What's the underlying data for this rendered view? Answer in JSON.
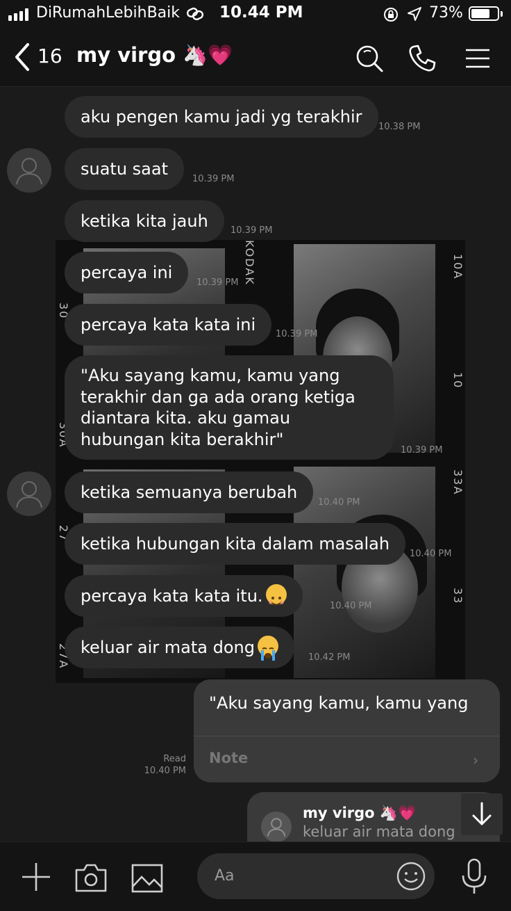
{
  "status_bar": {
    "carrier": "DiRumahLebihBaik",
    "time": "10.44 PM",
    "battery_percent": "73%",
    "battery_level": 0.73
  },
  "header": {
    "unread_count": "16",
    "chat_title": "my virgo 🦄💗"
  },
  "messages": [
    {
      "text": "aku pengen kamu jadi yg terakhir",
      "time": "10.38 PM"
    },
    {
      "text": "suatu saat",
      "time": "10.39 PM"
    },
    {
      "text": "ketika kita jauh",
      "time": "10.39 PM"
    },
    {
      "text": "percaya ini",
      "time": "10.39 PM"
    },
    {
      "text": "percaya kata kata ini",
      "time": "10.39 PM"
    },
    {
      "text": "\"Aku sayang kamu, kamu yang terakhir dan ga ada orang ketiga diantara kita. aku gamau hubungan kita berakhir\"",
      "time": "10.39 PM"
    },
    {
      "text": "ketika semuanya berubah",
      "time": "10.40 PM"
    },
    {
      "text": "ketika hubungan kita dalam masalah",
      "time": "10.40 PM"
    },
    {
      "text": "percaya kata kata itu.",
      "time": "10.40 PM"
    },
    {
      "text": "keluar air mata dong",
      "time": "10.42 PM"
    }
  ],
  "film_edge_labels": [
    "KODAK",
    "30",
    "30A",
    "27",
    "27A",
    "10A",
    "10",
    "33A",
    "33"
  ],
  "sent": {
    "read_label": "Read",
    "read_time": "10.40 PM",
    "note_text": "\"Aku sayang kamu, kamu yang",
    "note_label": "Note"
  },
  "preview": {
    "name": "my virgo 🦄💗",
    "message": "keluar air mata dong"
  },
  "input": {
    "placeholder": "Aa"
  },
  "icons": [
    "back-chevron-icon",
    "search-icon",
    "phone-icon",
    "menu-icon",
    "plus-icon",
    "camera-icon",
    "image-icon",
    "emoji-icon",
    "microphone-icon",
    "arrow-down-icon"
  ]
}
